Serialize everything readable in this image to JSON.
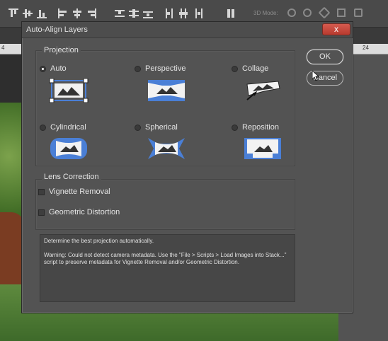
{
  "toolbar": {
    "icons": [
      "align-top-edges-icon",
      "align-vertical-centers-icon",
      "align-bottom-edges-icon",
      "align-left-edges-icon",
      "align-horizontal-centers-icon",
      "align-right-edges-icon",
      "distribute-top-icon",
      "distribute-vertical-centers-icon",
      "distribute-bottom-icon",
      "distribute-left-icon",
      "distribute-horizontal-centers-icon",
      "distribute-right-icon",
      "auto-align-layers-icon"
    ],
    "mode_label": "3D Mode:"
  },
  "ruler": {
    "left_number": "4",
    "right_number": "24"
  },
  "dialog": {
    "title": "Auto-Align Layers",
    "close_label": "x",
    "projection": {
      "legend": "Projection",
      "options": [
        {
          "label": "Auto",
          "selected": true,
          "icon": "auto-projection-icon"
        },
        {
          "label": "Perspective",
          "selected": false,
          "icon": "perspective-projection-icon"
        },
        {
          "label": "Collage",
          "selected": false,
          "icon": "collage-projection-icon"
        },
        {
          "label": "Cylindrical",
          "selected": false,
          "icon": "cylindrical-projection-icon"
        },
        {
          "label": "Spherical",
          "selected": false,
          "icon": "spherical-projection-icon"
        },
        {
          "label": "Reposition",
          "selected": false,
          "icon": "reposition-projection-icon"
        }
      ]
    },
    "lens": {
      "legend": "Lens Correction",
      "options": [
        {
          "label": "Vignette Removal",
          "checked": false
        },
        {
          "label": "Geometric Distortion",
          "checked": false
        }
      ]
    },
    "buttons": {
      "ok": "OK",
      "cancel": "Cancel"
    },
    "description": {
      "line1": "Determine the best projection automatically.",
      "line2": "Warning: Could not detect camera metadata. Use the \"File > Scripts > Load Images into Stack...\" script to preserve metadata for Vignette Removal and/or Geometric Distortion."
    }
  },
  "colors": {
    "accent": "#4a7fd6",
    "dialog_bg": "#535353",
    "close": "#c8493d"
  }
}
